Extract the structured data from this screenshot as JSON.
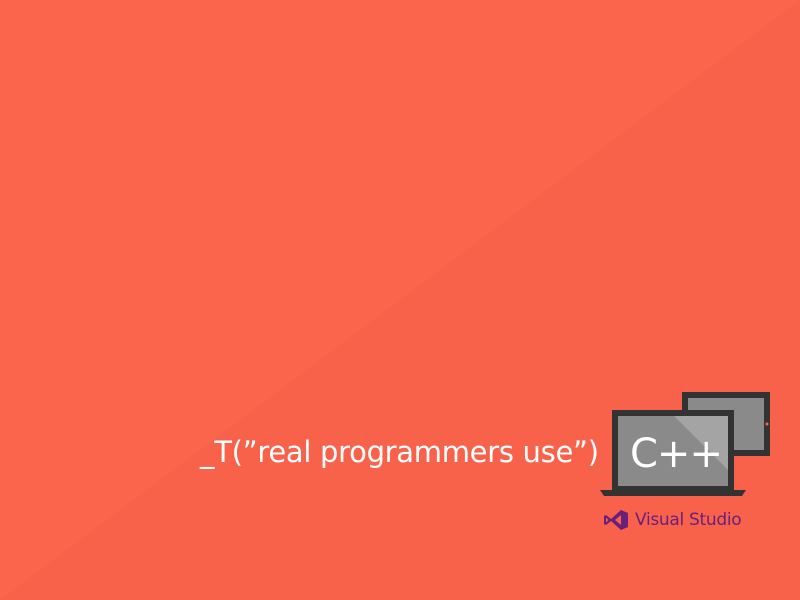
{
  "wallpaper": {
    "background_color": "#fb654c",
    "tagline": "_T(”real programmers use”)",
    "tagline_color": "#ffffff"
  },
  "graphic": {
    "screen_label": "C++",
    "device_frame_color": "#333333",
    "screen_color": "#8a8a8a"
  },
  "brand": {
    "logo_icon": "visual-studio-icon",
    "name": "Visual Studio",
    "color": "#68217a"
  }
}
